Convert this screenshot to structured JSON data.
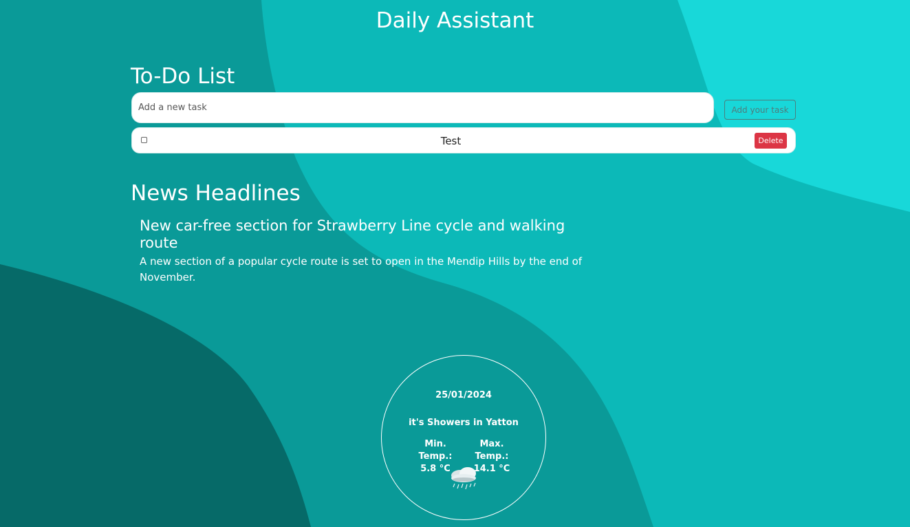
{
  "app": {
    "title": "Daily Assistant"
  },
  "todo": {
    "title": "To-Do List",
    "input_placeholder": "Add a new task",
    "input_value": "",
    "add_button_label": "Add your task",
    "tasks": [
      {
        "text": "Test",
        "done": false,
        "delete_label": "Delete"
      }
    ]
  },
  "news": {
    "title": "News Headlines",
    "items": [
      {
        "headline": "New car-free section for Strawberry Line cycle and walking route",
        "summary": "A new section of a popular cycle route is set to open in the Mendip Hills by the end of November."
      }
    ]
  },
  "weather": {
    "date": "25/01/2024",
    "summary": "it's Showers in Yatton",
    "min_label": "Min. Temp.:",
    "min_value": "5.8 °C",
    "max_label": "Max. Temp.:",
    "max_value": "14.1 °C",
    "icon": "showers-icon"
  },
  "colors": {
    "background_dark": "#055e5c",
    "background_mid": "#0a9a98",
    "background_light": "#19d9da",
    "delete": "#dc3545"
  }
}
